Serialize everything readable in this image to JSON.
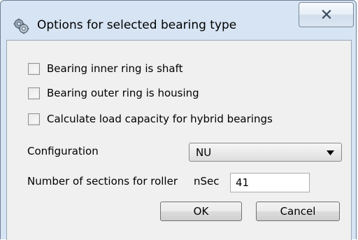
{
  "window": {
    "title": "Options for selected bearing type",
    "app_icon": "gears-icon",
    "close_icon": "close-x-icon"
  },
  "checkboxes": [
    {
      "label": "Bearing inner ring is shaft",
      "checked": false
    },
    {
      "label": "Bearing outer ring is housing",
      "checked": false
    },
    {
      "label": "Calculate load capacity for hybrid bearings",
      "checked": false
    }
  ],
  "configuration": {
    "label": "Configuration",
    "selected": "NU"
  },
  "sections": {
    "label": "Number of sections for roller",
    "symbol": "nSec",
    "value": "41"
  },
  "buttons": {
    "ok": "OK",
    "cancel": "Cancel"
  }
}
